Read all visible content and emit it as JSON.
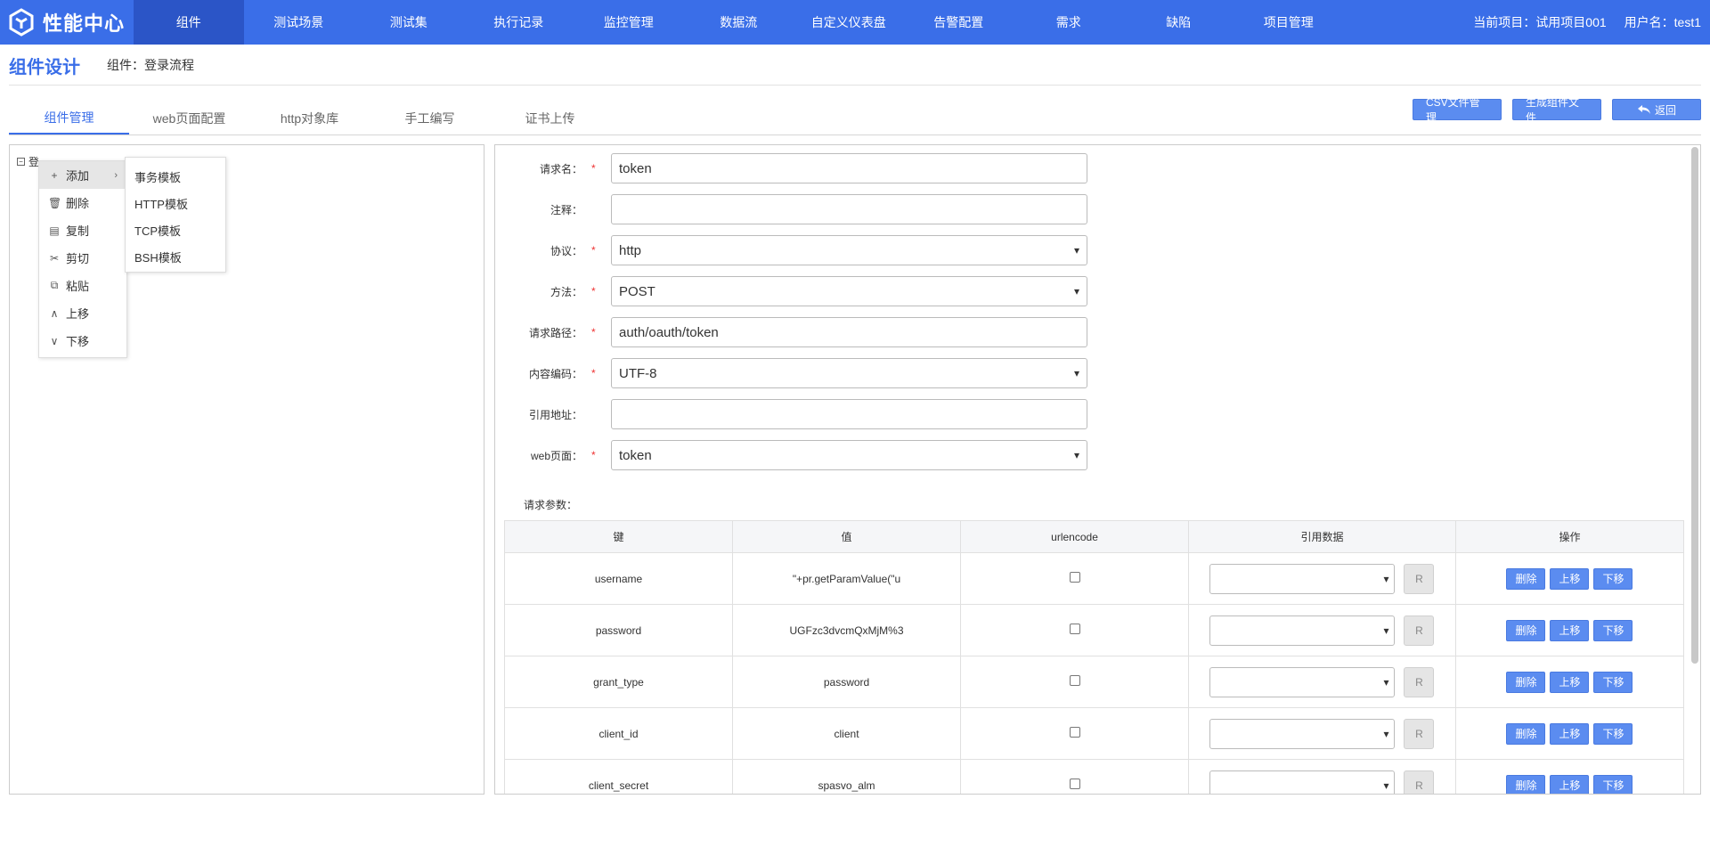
{
  "header": {
    "brand": "性能中心",
    "nav": [
      "组件",
      "测试场景",
      "测试集",
      "执行记录",
      "监控管理",
      "数据流",
      "自定义仪表盘",
      "告警配置",
      "需求",
      "缺陷",
      "项目管理"
    ],
    "current_project": "当前项目：试用项目001",
    "user": "用户名：test1"
  },
  "page": {
    "title": "组件设计",
    "breadcrumb": "组件：登录流程"
  },
  "tabs": [
    "组件管理",
    "web页面配置",
    "http对象库",
    "手工编写",
    "证书上传"
  ],
  "buttons": {
    "csv": "CSV文件管理",
    "generate": "生成组件文件",
    "back": "返回"
  },
  "tree": {
    "toggle": "⊟",
    "node": "登"
  },
  "context_menu": [
    "添加",
    "删除",
    "复制",
    "剪切",
    "粘贴",
    "上移",
    "下移"
  ],
  "submenu": [
    "事务模板",
    "HTTP模板",
    "TCP模板",
    "BSH模板"
  ],
  "form": {
    "request_name_label": "请求名：",
    "request_name": "token",
    "comment_label": "注释：",
    "comment": "",
    "protocol_label": "协议：",
    "protocol": "http",
    "method_label": "方法：",
    "method": "POST",
    "path_label": "请求路径：",
    "path": "auth/oauth/token",
    "encoding_label": "内容编码：",
    "encoding": "UTF-8",
    "ref_url_label": "引用地址：",
    "ref_url": "",
    "web_page_label": "web页面：",
    "web_page": "token",
    "required_mark": "*"
  },
  "params": {
    "label": "请求参数：",
    "headers": [
      "键",
      "值",
      "urlencode",
      "引用数据",
      "操作"
    ],
    "rows": [
      {
        "key": "username",
        "value": "\"+pr.getParamValue(\"u"
      },
      {
        "key": "password",
        "value": "UGFzc3dvcmQxMjM%3"
      },
      {
        "key": "grant_type",
        "value": "password"
      },
      {
        "key": "client_id",
        "value": "client"
      },
      {
        "key": "client_secret",
        "value": "spasvo_alm"
      }
    ],
    "r_label": "R",
    "op_delete": "删除",
    "op_up": "上移",
    "op_down": "下移"
  }
}
